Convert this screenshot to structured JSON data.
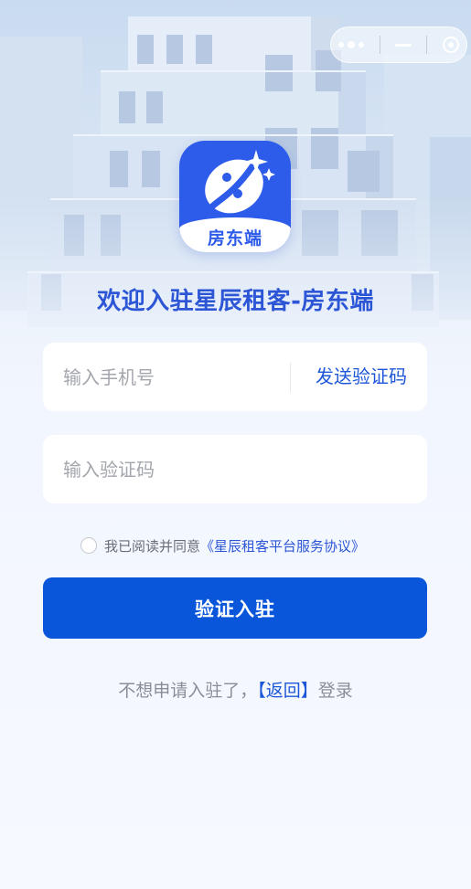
{
  "app": {
    "logo_text": "房东端",
    "title": "欢迎入驻星辰租客-房东端"
  },
  "form": {
    "phone_placeholder": "输入手机号",
    "send_code_label": "发送验证码",
    "code_placeholder": "输入验证码"
  },
  "agreement": {
    "prefix": "我已阅读并同意",
    "link": "《星辰租客平台服务协议》"
  },
  "submit_label": "验证入驻",
  "footer": {
    "prefix": "不想申请入驻了，",
    "link": "【返回】",
    "suffix": "登录"
  },
  "colors": {
    "accent": "#0a56db",
    "title": "#2d56d6",
    "logo_bg": "#2d5bea"
  },
  "icons": [
    "more-dots-icon",
    "minimize-icon",
    "close-target-icon",
    "app-logo-icon"
  ]
}
